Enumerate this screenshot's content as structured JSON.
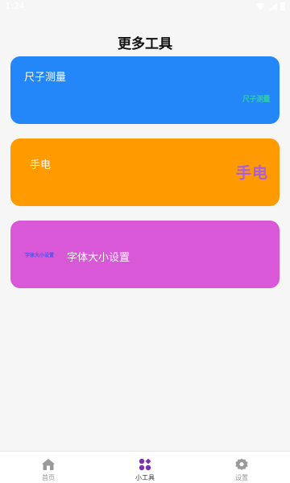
{
  "status_bar": {
    "time": "1:24"
  },
  "header": {
    "title": "更多工具"
  },
  "cards": {
    "ruler": {
      "label": "尺子测量",
      "badge": "尺子测量",
      "color": "#2387f9"
    },
    "torch": {
      "label": "手电",
      "badge": "手电",
      "color": "#ff9a00"
    },
    "font_size": {
      "label": "字体大小设置",
      "badge": "字体大小设置",
      "color": "#d858d8"
    }
  },
  "bottom_nav": {
    "items": [
      {
        "label": "首页",
        "icon": "home-icon",
        "active": false
      },
      {
        "label": "小工具",
        "icon": "tools-icon",
        "active": true
      },
      {
        "label": "设置",
        "icon": "gear-icon",
        "active": false
      }
    ],
    "active_color": "#7b2fb8",
    "inactive_color": "#9a9a9a"
  }
}
